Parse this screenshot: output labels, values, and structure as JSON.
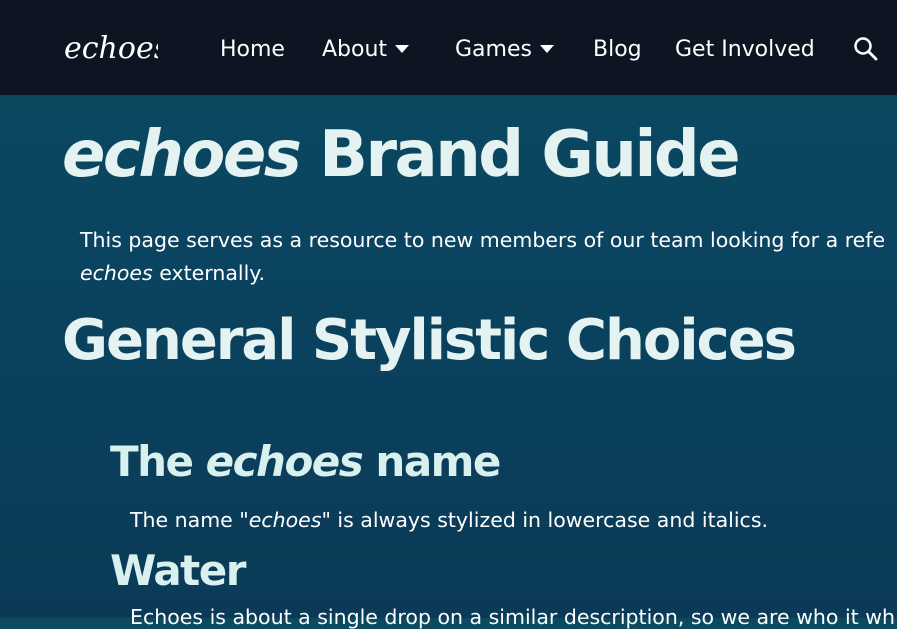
{
  "nav": {
    "logo_text": "echoes",
    "items": [
      {
        "label": "Home"
      },
      {
        "label": "About",
        "has_dropdown": true
      },
      {
        "label": "Games",
        "has_dropdown": true
      },
      {
        "label": "Blog"
      },
      {
        "label": "Get Involved"
      }
    ],
    "search_icon": "search-icon"
  },
  "page": {
    "title_em": "echoes",
    "title_rest": " Brand Guide",
    "intro_line1": "This page serves as a resource to new members of our team looking for a refe",
    "intro_line2_em": "echoes",
    "intro_line2_rest": " externally.",
    "section_title": "General Stylistic Choices",
    "name_heading_pre": "The ",
    "name_heading_em": "echoes",
    "name_heading_post": " name",
    "name_para_pre": "The name \"",
    "name_para_em": "echoes",
    "name_para_post": "\" is always stylized in lowercase and italics.",
    "water_heading": "Water",
    "water_para": "Echoes is about a single drop on a similar description, so we are who it wh"
  },
  "colors": {
    "navbar_bg": "#0d1522",
    "page_bg": "#0b4a5f",
    "heading": "#e4f3f1",
    "body_text": "#ffffff"
  }
}
